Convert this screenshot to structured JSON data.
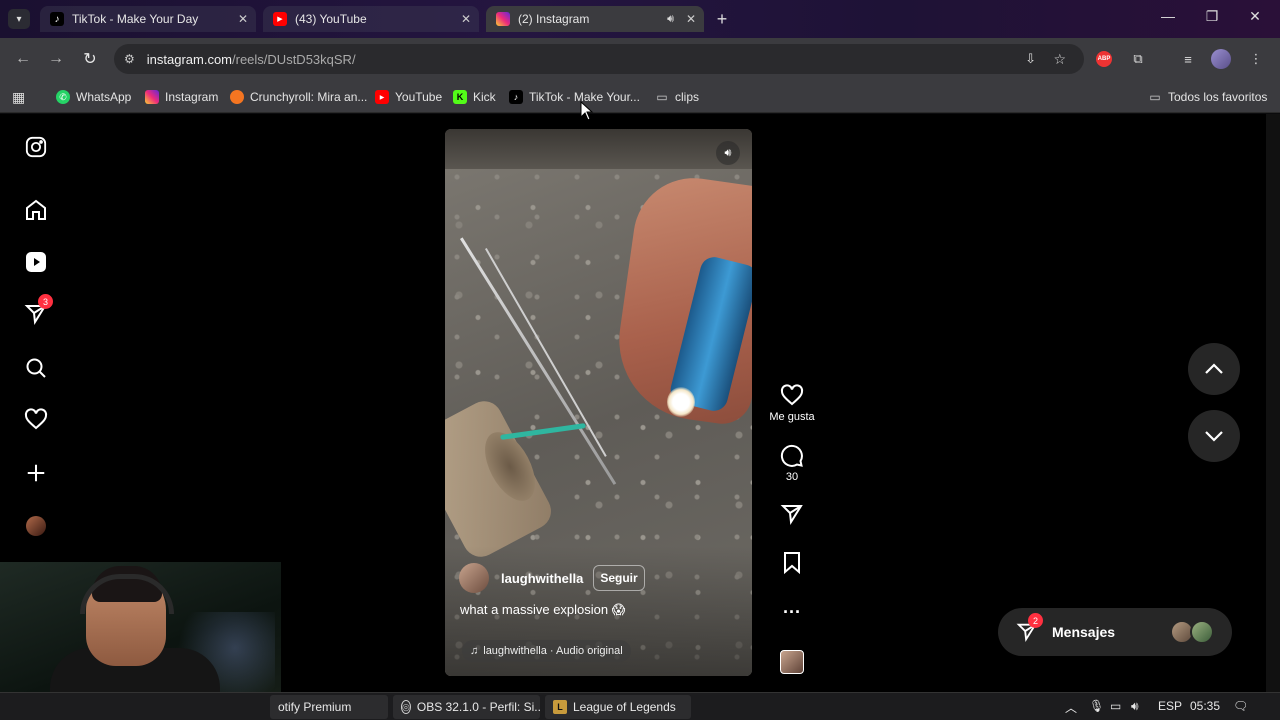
{
  "browser": {
    "tabs": [
      {
        "title": "TikTok - Make Your Day",
        "icon": "tiktok-icon",
        "state": "inactive"
      },
      {
        "title": "(43) YouTube",
        "icon": "youtube-icon",
        "state": "inactive"
      },
      {
        "title": "(2) Instagram",
        "icon": "instagram-icon",
        "state": "active",
        "audio": true
      }
    ],
    "url": {
      "host": "instagram.com",
      "path": "/reels/DUstD53kqSR/"
    },
    "bookmarks": [
      {
        "label": "WhatsApp",
        "icon": "whatsapp-icon",
        "color": "#25d366"
      },
      {
        "label": "Instagram",
        "icon": "instagram-icon",
        "color": "#d6249f"
      },
      {
        "label": "Crunchyroll: Mira an...",
        "icon": "crunchyroll-icon",
        "color": "#f47521"
      },
      {
        "label": "YouTube",
        "icon": "youtube-icon",
        "color": "#ff0000"
      },
      {
        "label": "Kick",
        "icon": "kick-icon",
        "color": "#53fc18"
      },
      {
        "label": "TikTok - Make Your...",
        "icon": "tiktok-icon",
        "color": "#000000"
      },
      {
        "label": "clips",
        "icon": "folder-icon",
        "color": ""
      }
    ],
    "all_bookmarks": "Todos los favoritos"
  },
  "instagram": {
    "sidebar": {
      "notifications_badge": "3"
    },
    "reel": {
      "username": "laughwithella",
      "follow_label": "Seguir",
      "caption": "what a massive explosion 😱",
      "audio": "laughwithella · Audio original"
    },
    "actions": {
      "like_label": "Me gusta",
      "comments_count": "30"
    },
    "messages": {
      "label": "Mensajes",
      "badge": "2"
    }
  },
  "taskbar": {
    "items": [
      {
        "label": "otify Premium",
        "icon": "spotify-icon"
      },
      {
        "label": "OBS 32.1.0 - Perfil: Si...",
        "icon": "obs-icon"
      },
      {
        "label": "League of Legends",
        "icon": "league-icon"
      }
    ],
    "language": "ESP",
    "time": "05:35"
  },
  "colors": {
    "accent_badge": "#ff3040",
    "page_bg": "#000000",
    "chrome_toolbar": "#3b3b3f"
  }
}
